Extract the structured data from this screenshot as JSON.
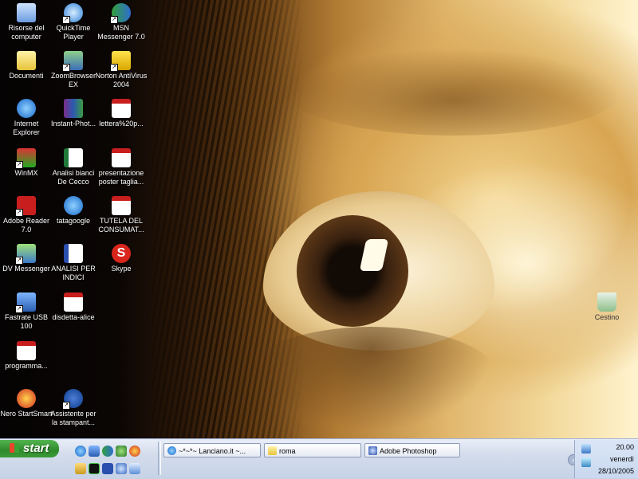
{
  "desktop_icons": [
    {
      "name": "Risorse del computer",
      "icon": "my-computer-icon"
    },
    {
      "name": "Documenti",
      "icon": "documents-folder-icon"
    },
    {
      "name": "Internet Explorer",
      "icon": "internet-explorer-icon"
    },
    {
      "name": "WinMX",
      "icon": "winmx-icon"
    },
    {
      "name": "Adobe Reader 7.0",
      "icon": "adobe-reader-icon"
    },
    {
      "name": "DV Messenger",
      "icon": "dv-messenger-icon"
    },
    {
      "name": "Fastrate USB 100",
      "icon": "fastrate-usb-icon"
    },
    {
      "name": "programma...",
      "icon": "pdf-icon"
    },
    {
      "name": "Nero StartSmart",
      "icon": "nero-icon"
    },
    {
      "name": "QuickTime Player",
      "icon": "quicktime-icon"
    },
    {
      "name": "ZoomBrowser EX",
      "icon": "zoombrowser-icon"
    },
    {
      "name": "Instant-Phot...",
      "icon": "winrar-icon"
    },
    {
      "name": "Analisi bianci De Cecco",
      "icon": "excel-icon"
    },
    {
      "name": "tatagoogle",
      "icon": "internet-explorer-icon"
    },
    {
      "name": "ANALISI PER INDICI",
      "icon": "word-icon"
    },
    {
      "name": "disdetta-alice",
      "icon": "pdf-icon"
    },
    {
      "name": "Assistente per la stampant...",
      "icon": "hp-icon"
    },
    {
      "name": "MSN Messenger 7.0",
      "icon": "msn-icon"
    },
    {
      "name": "Norton AntiVirus 2004",
      "icon": "norton-icon"
    },
    {
      "name": "lettera%20p...",
      "icon": "pdf-icon"
    },
    {
      "name": "presentazione poster taglia...",
      "icon": "pdf-icon"
    },
    {
      "name": "TUTELA DEL CONSUMAT...",
      "icon": "pdf-icon"
    },
    {
      "name": "Skype",
      "icon": "skype-icon"
    },
    {
      "name": "Cestino",
      "icon": "recycle-bin-icon"
    }
  ],
  "taskbar": {
    "start_label": "start",
    "buttons": [
      {
        "label": "~*~*~ Lanciano.it ~...",
        "icon": "internet-explorer-icon"
      },
      {
        "label": "roma",
        "icon": "folder-icon"
      },
      {
        "label": "Adobe Photoshop",
        "icon": "photoshop-icon"
      }
    ],
    "clock": {
      "time": "20.00",
      "day": "venerdì",
      "date": "28/10/2005"
    }
  },
  "colors": {
    "start_green": "#3b9a38",
    "taskbar_blue": "#c6d2e6"
  }
}
